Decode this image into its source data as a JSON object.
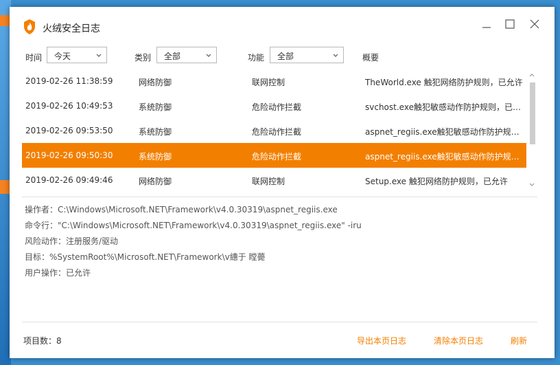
{
  "app": {
    "title": "火绒安全日志"
  },
  "colors": {
    "accent": "#f37f00",
    "window_bg": "#ffffff"
  },
  "filters": {
    "time_label": "时间",
    "time_value": "今天",
    "category_label": "类别",
    "category_value": "全部",
    "function_label": "功能",
    "function_value": "全部",
    "summary_label": "概要"
  },
  "rows": [
    {
      "time": "2019-02-26 11:38:59",
      "category": "网络防御",
      "function": "联网控制",
      "summary": "TheWorld.exe 触犯网络防护规则，已允许"
    },
    {
      "time": "2019-02-26 10:49:53",
      "category": "系统防御",
      "function": "危险动作拦截",
      "summary": "svchost.exe触犯敏感动作防护规则，已允许"
    },
    {
      "time": "2019-02-26 09:53:50",
      "category": "系统防御",
      "function": "危险动作拦截",
      "summary": "aspnet_regiis.exe触犯敏感动作防护规则，已允许"
    },
    {
      "time": "2019-02-26 09:50:30",
      "category": "系统防御",
      "function": "危险动作拦截",
      "summary": "aspnet_regiis.exe触犯敏感动作防护规则，已允许"
    },
    {
      "time": "2019-02-26 09:49:46",
      "category": "网络防御",
      "function": "联网控制",
      "summary": "Setup.exe 触犯网络防护规则，已允许"
    }
  ],
  "selected_index": 3,
  "detail": {
    "operator": "操作者：C:\\Windows\\Microsoft.NET\\Framework\\v4.0.30319\\aspnet_regiis.exe",
    "command": "命令行：\"C:\\Windows\\Microsoft.NET\\Framework\\v4.0.30319\\aspnet_regiis.exe\" -iru",
    "risk": "风险动作：注册服务/驱动",
    "target": "目标：%SystemRoot%\\Microsoft.NET\\Framework\\v繐于 瞠薨",
    "user_action": "用户操作：已允许"
  },
  "footer": {
    "count": "项目数：8",
    "export": "导出本页日志",
    "clear": "清除本页日志",
    "refresh": "刷新"
  },
  "icons": {
    "logo": "huorong-flame-icon",
    "minimize": "minimize-icon",
    "maximize": "maximize-icon",
    "close": "close-icon",
    "dropdown": "chevron-down-icon",
    "scroll_up": "chevron-up-icon",
    "scroll_down": "chevron-down-icon"
  }
}
